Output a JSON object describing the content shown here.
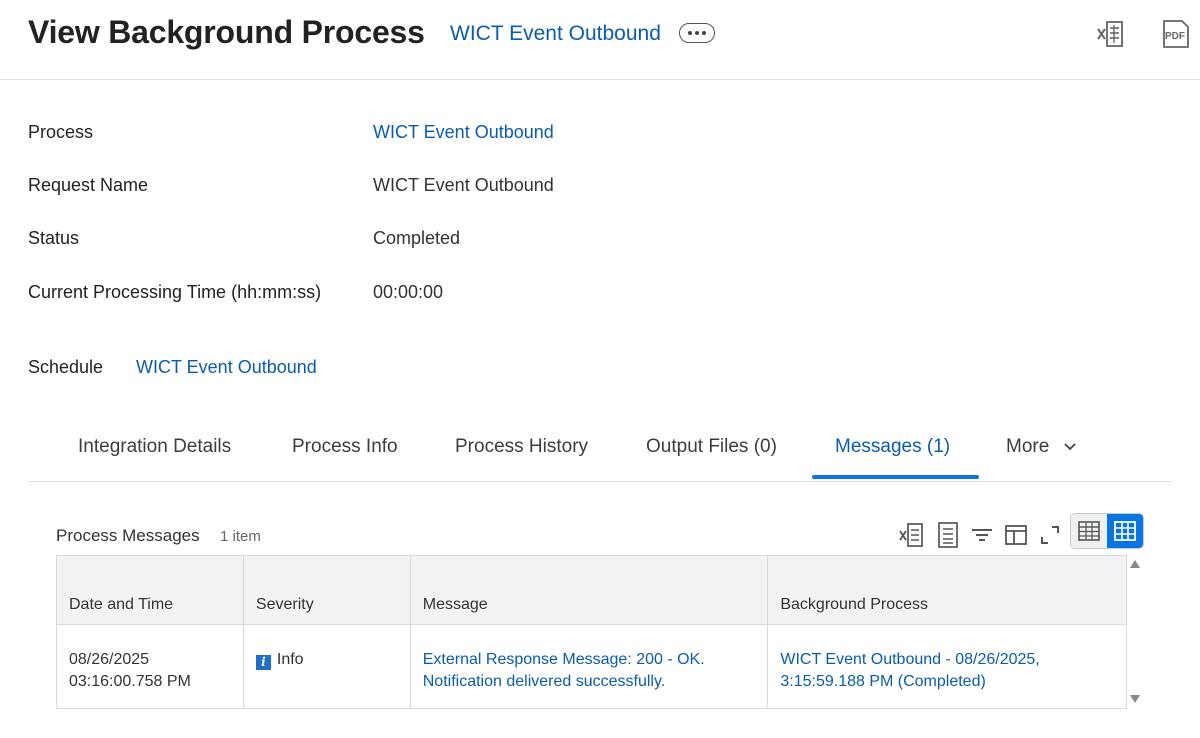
{
  "header": {
    "title": "View Background Process",
    "related_link": "WICT Event Outbound",
    "export_excel_icon": "excel-export-icon",
    "export_pdf_icon": "pdf-export-icon",
    "pdf_label": "PDF"
  },
  "fields": [
    {
      "label": "Process",
      "value": "WICT Event Outbound",
      "is_link": true
    },
    {
      "label": "Request Name",
      "value": "WICT Event Outbound",
      "is_link": false
    },
    {
      "label": "Status",
      "value": "Completed",
      "is_link": false
    },
    {
      "label": "Current Processing Time (hh:mm:ss)",
      "value": "00:00:00",
      "is_link": false
    }
  ],
  "schedule": {
    "label": "Schedule",
    "value": "WICT Event Outbound"
  },
  "tabs": [
    {
      "label": "Integration Details",
      "active": false
    },
    {
      "label": "Process Info",
      "active": false
    },
    {
      "label": "Process History",
      "active": false
    },
    {
      "label": "Output Files (0)",
      "active": false
    },
    {
      "label": "Messages (1)",
      "active": true
    },
    {
      "label": "More",
      "active": false
    }
  ],
  "grid": {
    "title": "Process Messages",
    "count": "1 item",
    "columns": [
      "Date and Time",
      "Severity",
      "Message",
      "Background Process"
    ],
    "rows": [
      {
        "date_line1": "08/26/2025",
        "date_line2": "03:16:00.758 PM",
        "severity": "Info",
        "message_line1": "External Response Message: 200 - OK.",
        "message_line2": "Notification delivered successfully.",
        "process_line1": "WICT Event Outbound - 08/26/2025,",
        "process_line2": "3:15:59.188 PM (Completed)"
      }
    ]
  },
  "colors": {
    "link": "#0b5cad",
    "accent": "#0875e1",
    "info_badge": "#1f6fc9"
  }
}
